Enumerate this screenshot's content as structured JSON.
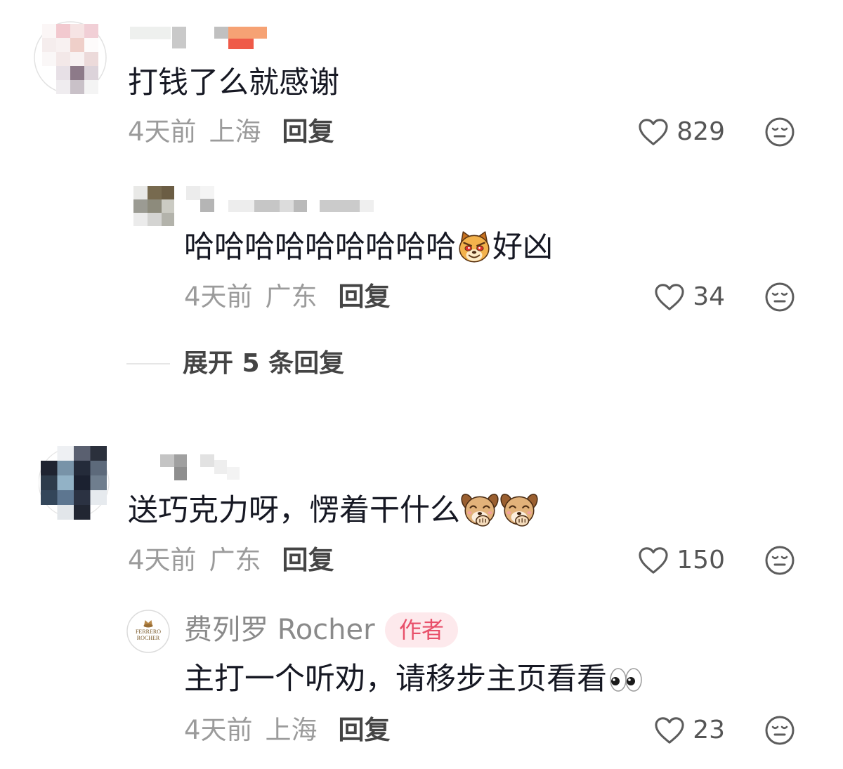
{
  "theme": {
    "text": "#161823",
    "meta": "#9b9b9b",
    "action": "#454545",
    "badge_bg": "#fde9ec",
    "badge_text": "#e8506a"
  },
  "icons": {
    "like": "heart-outline-icon",
    "dislike": "meh-face-icon"
  },
  "comments": [
    {
      "text": "打钱了么就感谢",
      "time": "4天前",
      "location": "上海",
      "reply_label": "回复",
      "likes": "829",
      "replies": [
        {
          "text_before": "哈哈哈哈哈哈哈哈哈",
          "emoji": "smug-dog-emoji",
          "text_after": "好凶",
          "time": "4天前",
          "location": "广东",
          "reply_label": "回复",
          "likes": "34"
        }
      ],
      "expand_label": "展开 5 条回复"
    },
    {
      "text": "送巧克力呀，愣着干什么",
      "emojis": [
        "snicker-dog-emoji",
        "snicker-dog-emoji"
      ],
      "time": "4天前",
      "location": "广东",
      "reply_label": "回复",
      "likes": "150",
      "replies": [
        {
          "author_name": "费列罗 Rocher",
          "author_badge": "作者",
          "avatar_logo_text": [
            "FERRERO",
            "ROCHER"
          ],
          "text": "主打一个听劝，请移步主页看看",
          "emoji": "eyes-emoji",
          "time": "4天前",
          "location": "上海",
          "reply_label": "回复",
          "likes": "23"
        }
      ]
    }
  ]
}
